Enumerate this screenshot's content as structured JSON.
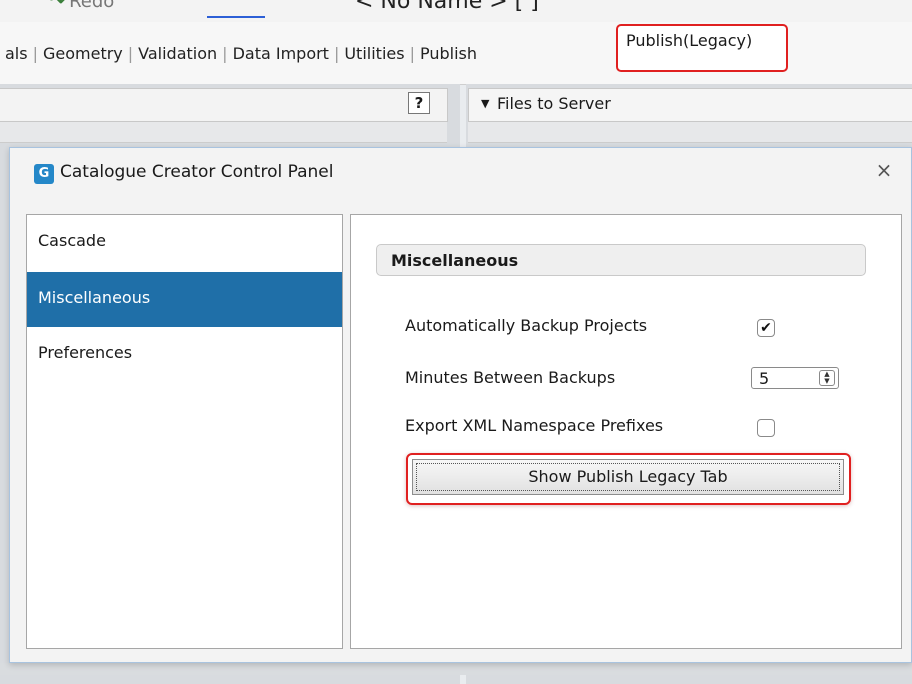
{
  "app": {
    "redo_label": "Redo",
    "document_title": "< No Name > [ ]"
  },
  "ribbon": {
    "tabs": [
      "als",
      "Geometry",
      "Validation",
      "Data Import",
      "Utilities",
      "Publish"
    ],
    "highlighted_tab": "Publish(Legacy)"
  },
  "left_pane": {
    "help_label": "?"
  },
  "right_pane": {
    "files_header": "Files to Server"
  },
  "dialog": {
    "title": "Catalogue Creator Control Panel",
    "close_glyph": "×",
    "nav": {
      "items": [
        "Cascade",
        "Miscellaneous",
        "Preferences"
      ],
      "selected": "Miscellaneous"
    },
    "section_title": "Miscellaneous",
    "options": {
      "auto_backup": {
        "label": "Automatically Backup Projects",
        "checked": true
      },
      "minutes_between_backups": {
        "label": "Minutes Between Backups",
        "value": "5"
      },
      "export_xml_ns": {
        "label": "Export XML Namespace Prefixes",
        "checked": false
      }
    },
    "show_legacy_button": "Show Publish Legacy Tab"
  },
  "colors": {
    "selection": "#1f6fa8",
    "highlight_outline": "#e02020",
    "dialog_border": "#a8c3df"
  }
}
